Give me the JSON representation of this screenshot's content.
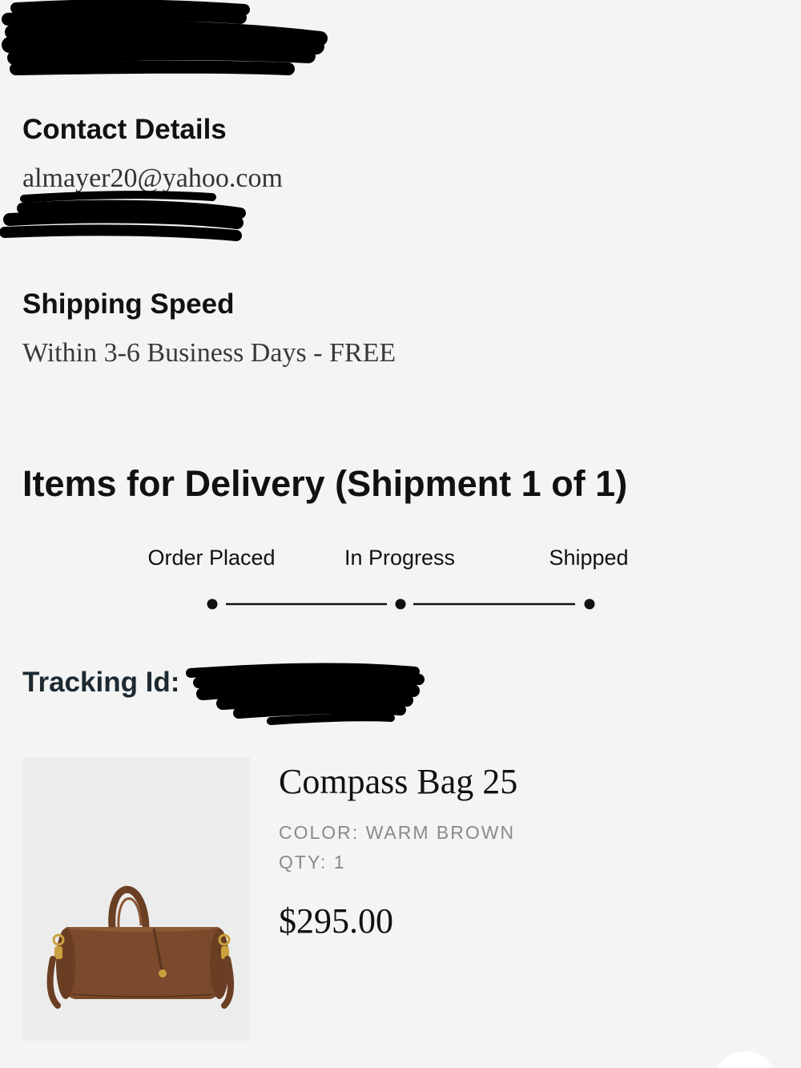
{
  "contact": {
    "heading": "Contact Details",
    "email": "almayer20@yahoo.com"
  },
  "shipping": {
    "heading": "Shipping Speed",
    "value": "Within 3-6 Business Days - FREE"
  },
  "delivery": {
    "title": "Items for Delivery (Shipment 1 of 1)",
    "steps": [
      {
        "label": "Order Placed"
      },
      {
        "label": "In Progress"
      },
      {
        "label": "Shipped"
      }
    ]
  },
  "tracking": {
    "label": "Tracking Id:"
  },
  "item": {
    "name": "Compass Bag 25",
    "color_label": "COLOR:",
    "color_value": "WARM BROWN",
    "qty_label": "QTY:",
    "qty_value": "1",
    "price": "$295.00",
    "image_icon": "brown-suede-duffel-bag"
  },
  "colors": {
    "background": "#f4f4f4",
    "text": "#111111",
    "muted": "#8a8a8a",
    "bag_brown": "#7b4a2c"
  }
}
